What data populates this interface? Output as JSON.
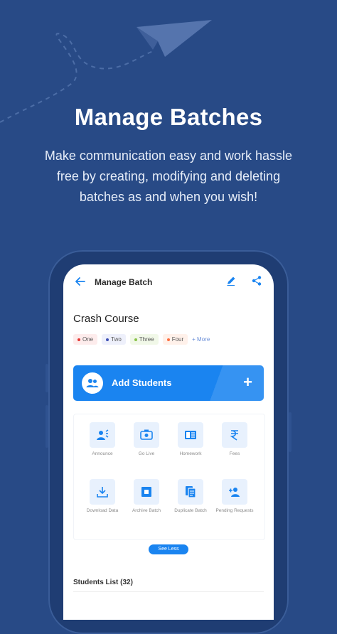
{
  "hero": {
    "headline": "Manage Batches",
    "line1": "Make communication easy  and work hassle",
    "line2": "free by creating, modifying and deleting",
    "line3": "batches as and when you wish!"
  },
  "app": {
    "title": "Manage Batch",
    "course_name": "Crash Course",
    "tags": [
      {
        "label": "One",
        "color": "#e53935",
        "bg": "#fdecec"
      },
      {
        "label": "Two",
        "color": "#3f51b5",
        "bg": "#eef0fb"
      },
      {
        "label": "Three",
        "color": "#8bc34a",
        "bg": "#f1f8e8"
      },
      {
        "label": "Four",
        "color": "#ff7043",
        "bg": "#fff1ea"
      }
    ],
    "tags_more": "+ More",
    "add_students_label": "Add Students",
    "tiles": [
      {
        "label": "Announce",
        "icon": "announce-icon"
      },
      {
        "label": "Go Live",
        "icon": "live-icon"
      },
      {
        "label": "Homework",
        "icon": "homework-icon"
      },
      {
        "label": "Fees",
        "icon": "rupee-icon"
      },
      {
        "label": "Download Data",
        "icon": "download-icon"
      },
      {
        "label": "Archive Batch",
        "icon": "archive-icon"
      },
      {
        "label": "Duplicate Batch",
        "icon": "duplicate-icon"
      },
      {
        "label": "Pending Requests",
        "icon": "add-person-icon"
      }
    ],
    "see_less": "See Less",
    "students_list": "Students List (32)"
  },
  "colors": {
    "background": "#284a86",
    "accent": "#1a84f0"
  }
}
